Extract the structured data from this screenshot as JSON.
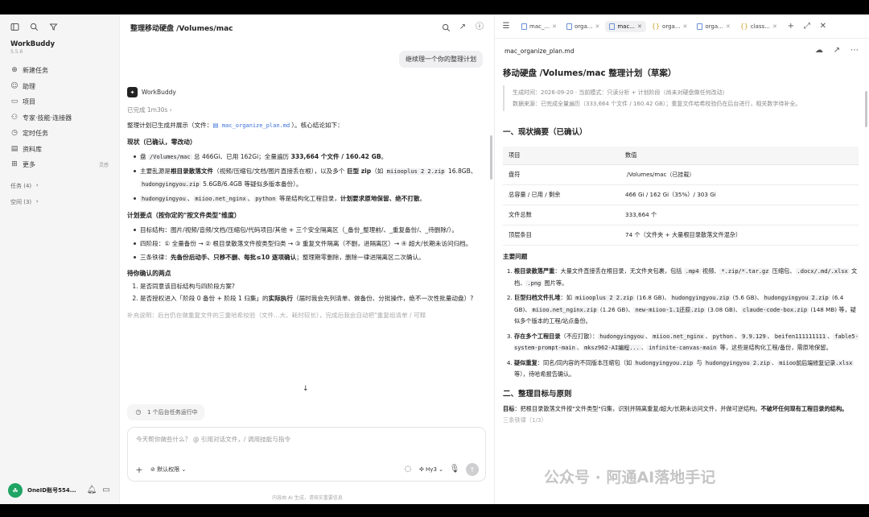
{
  "sidebar": {
    "app_name": "WorkBuddy",
    "version": "5.5.6",
    "items": [
      {
        "label": "新建任务",
        "icon": "plus-circle-icon"
      },
      {
        "label": "助理",
        "icon": "assistant-icon"
      },
      {
        "label": "项目",
        "icon": "folder-icon"
      },
      {
        "label": "专家·技能·连接器",
        "icon": "expert-icon"
      },
      {
        "label": "定时任务",
        "icon": "clock-icon"
      },
      {
        "label": "资料库",
        "icon": "library-icon"
      },
      {
        "label": "更多",
        "icon": "grid-icon",
        "tag": "灵感"
      }
    ],
    "sections": [
      {
        "label": "任务 (4)"
      },
      {
        "label": "空间 (3)"
      }
    ],
    "account": "OneID账号554..."
  },
  "chat": {
    "title": "整理移动硬盘 /Volumes/mac",
    "user_message": "继续理一个你的整理计划",
    "assistant_name": "WorkBuddy",
    "done_label": "已完成 1m30s",
    "intro_pre": "整理计划已生成并展示（文件：",
    "intro_file": "mac_organize_plan.md",
    "intro_post": "）。核心结论如下：",
    "h_status": "现状（已确认，零改动）",
    "s1a": "盘 ",
    "s1_code": "/Volumes/mac",
    "s1b": " 总 466Gi、已用 162Gi；全量遍历 ",
    "s1_bold": "333,664 个文件 / 160.42 GB",
    "s1c": "。",
    "s2a": "主要乱源是",
    "s2_bold1": "根目录散落文件",
    "s2b": "（视频/压缩包/文档/图片直接丢在根），以及多个 ",
    "s2_bold2": "巨型 zip",
    "s2c": "（如 ",
    "s2_code1": "miiooplus 2 2.zip",
    "s2d": " 16.8GB、",
    "s2_code2": "hudongyingyou.zip",
    "s2e": " 5.6GB/6.4GB 等疑似多版本备份）。",
    "s3_code1": "hudongyingyou",
    "s3_code2": "miioo.net_nginx",
    "s3_code3": "python",
    "s3a": " 等是结构化工程目录，",
    "s3_bold": "计划要求原地保留、绝不打散",
    "s3b": "。",
    "h_plan": "计划要点（按你定的\"按文件类型\"维度）",
    "p1": "目标结构：图片/视频/音频/文档/压缩包/代码项目/其他 + 三个安全隔离区（_备份_整理前/、_重复备份/、_待删除/）。",
    "p2": "四阶段：① 全量备份 → ② 根目录散落文件按类型归类 → ③ 重复文件隔离（不删，进隔离区）→ ④ 超大/长期未访问归档。",
    "p3a": "三条铁律：",
    "p3_bold": "先备份后动手、只移不删、每批≤10 逐项确认",
    "p3b": "；整理期零删除，删除一律进隔离区二次确认。",
    "h_confirm": "待你确认的两点",
    "c1": "是否同意该目标结构与四阶段方案?",
    "c2a": "是否授权进入「阶段 0 备份 + 阶段 1 归集」的",
    "c2_bold": "实际执行",
    "c2b": "（届时我会先列清单、做备份、分批操作，绝不一次性批量动盘）?",
    "faded": "补充说明：后台仍在做重复文件的三重哈希校验（文件...大、耗时较长），完成后我会自动把\"重复组清单 / 可释",
    "bg_task": "1 个后台任务运行中",
    "placeholder": "今天帮你做些什么？ @ 引用对话文件，/ 调用技能与指令",
    "permission": "默认权限",
    "model": "Hy3",
    "footnote": "内容由 AI 生成，请核实重要信息"
  },
  "doc": {
    "tabs": [
      {
        "label": "mac_...",
        "type": "md"
      },
      {
        "label": "orga...",
        "type": "md"
      },
      {
        "label": "mac...",
        "type": "md",
        "active": true
      },
      {
        "label": "orga...",
        "type": "json"
      },
      {
        "label": "orga...",
        "type": "md"
      },
      {
        "label": "class...",
        "type": "json"
      }
    ],
    "filename": "mac_organize_plan.md",
    "title": "移动硬盘 /Volumes/mac 整理计划（草案）",
    "meta1": "生成时间：2026-09-20 · 当前模式：只读分析 + 计划阶段（尚未对硬盘做任何改动）",
    "meta2": "数据来源：已完成全量遍历（333,664 个文件 / 160.42 GB）；重复文件哈希校验仍在后台进行，相关数字待补全。",
    "h_summary": "一、现状摘要（已确认）",
    "table_head": [
      "项目",
      "数值"
    ],
    "table_rows": [
      [
        "盘符",
        "/Volumes/mac（已挂载）"
      ],
      [
        "总容量 / 已用 / 剩余",
        "466 Gi / 162 Gi（35%）/ 303 Gi"
      ],
      [
        "文件总数",
        "333,664 个"
      ],
      [
        "顶层条目",
        "74 个（文件夹 + 大量根目录散落文件混杂）"
      ]
    ],
    "h_issues": "主要问题",
    "i1_bold": "根目录散落严重",
    "i1a": "：大量文件直接丢在根目录，无文件夹包裹，包括 ",
    "i1_c1": ".mp4",
    "i1b": " 视频、",
    "i1_c2": "*.zip/*.tar.gz",
    "i1c": " 压缩包、",
    "i1_c3": ".docx/.md/.xlsx",
    "i1d": " 文档、",
    "i1_c4": ".png",
    "i1e": " 图片等。",
    "i2_bold": "巨型归档文件扎堆",
    "i2a": "：如 ",
    "i2_c1": "miiooplus 2 2.zip",
    "i2b": " (16.8 GB)、",
    "i2_c2": "hudongyingyou.zip",
    "i2c": " (5.6 GB)、",
    "i2_c3": "hudongyingyou 2.zip",
    "i2d": " (6.4 GB)、",
    "i2_c4": "miioo.net_nginx.zip",
    "i2e": " (1.26 GB)、",
    "i2_c5": "new-miioo-1.1还原.zip",
    "i2f": " (3.08 GB)、",
    "i2_c6": "claude-code-box.zip",
    "i2g": " (148 MB) 等，疑似多个版本的工程/站点备份。",
    "i3_bold": "存在多个工程目录",
    "i3a": "（不应打散）：",
    "i3_c1": "hudongyingyou",
    "i3_c2": "miioo.net_nginx",
    "i3_c3": "python",
    "i3_c4": "9.9.129",
    "i3_c5": "beifen111111111",
    "i3_c6": "fable5-system-prompt-main",
    "i3_c7": "mksz962-AI编程...",
    "i3_c8": "infinite-canvas-main",
    "i3b": " 等，这些是结构化工程/备份，需原地保留。",
    "i4_bold": "疑似重复",
    "i4a": "：同名/同内容的不同版本压缩包（如 ",
    "i4_c1": "hudongyingyou.zip",
    "i4b": " 与 ",
    "i4_c2": "hudongyingyou 2.zip",
    "i4c": "、",
    "i4_c3": "miioo前后端修复记录.xlsx",
    "i4d": " 等），待哈希报告确认。",
    "h_goal": "二、整理目标与原则",
    "goal_label": "目标",
    "goal_text": "：把根目录散落文件按\"文件类型\"归集，识别并隔离重复/超大/长期未访问文件，并做可逆结构。",
    "goal_bold": "不破坏任何现有工程目录的结构。",
    "goal_more": "三条铁律（1/3）",
    "watermark": "公众号 · 阿通AI落地手记"
  }
}
